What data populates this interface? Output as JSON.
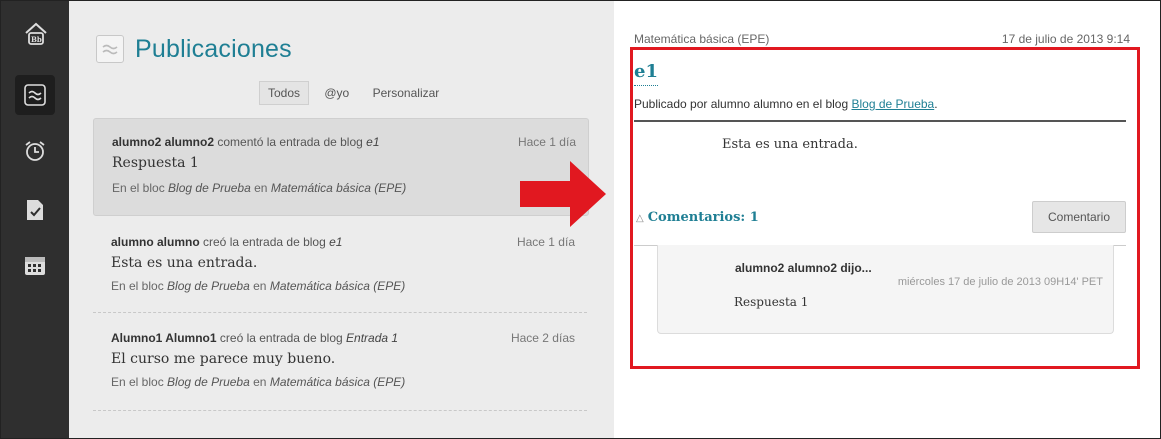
{
  "rail": {
    "items": [
      {
        "icon": "blackboard-home-icon"
      },
      {
        "icon": "stream-icon",
        "active": true
      },
      {
        "icon": "alarm-clock-icon"
      },
      {
        "icon": "grades-doc-icon"
      },
      {
        "icon": "calendar-icon"
      }
    ]
  },
  "feed": {
    "title": "Publicaciones",
    "filters": [
      "Todos",
      "@yo",
      "Personalizar"
    ],
    "active_filter": "Todos",
    "items": [
      {
        "author": "alumno2 alumno2",
        "action": "comentó la entrada de blog",
        "entry": "e1",
        "time": "Hace 1 día",
        "body": "Respuesta 1",
        "where_prefix": "En el bloc",
        "blog": "Blog de Prueba",
        "where_mid": "en",
        "course": "Matemática básica (EPE)"
      },
      {
        "author": "alumno alumno",
        "action": "creó la entrada de blog",
        "entry": "e1",
        "time": "Hace 1 día",
        "body": "Esta es una entrada.",
        "where_prefix": "En el bloc",
        "blog": "Blog de Prueba",
        "where_mid": "en",
        "course": "Matemática básica (EPE)"
      },
      {
        "author": "Alumno1 Alumno1",
        "action": "creó la entrada de blog",
        "entry": "Entrada 1",
        "time": "Hace 2 días",
        "body": "El curso me parece muy bueno.",
        "where_prefix": "En el bloc",
        "blog": "Blog de Prueba",
        "where_mid": "en",
        "course": "Matemática básica (EPE)"
      }
    ]
  },
  "detail": {
    "course": "Matemática básica (EPE)",
    "date": "17 de julio de 2013 9:14",
    "title": "e1",
    "posted_prefix": "Publicado por alumno alumno en el blog",
    "blog_link": "Blog de Prueba",
    "posted_suffix": ".",
    "body": "Esta es una entrada.",
    "comments_label": "Comentarios: 1",
    "comment_button": "Comentario",
    "comment": {
      "author": "alumno2 alumno2 dijo...",
      "date": "miércoles 17 de julio de 2013 09H14' PET",
      "text": "Respuesta 1"
    }
  },
  "colors": {
    "accent": "#1f7f94",
    "highlight_red": "#e11820",
    "rail": "#2f2f2f",
    "feed_bg": "#ececec"
  }
}
